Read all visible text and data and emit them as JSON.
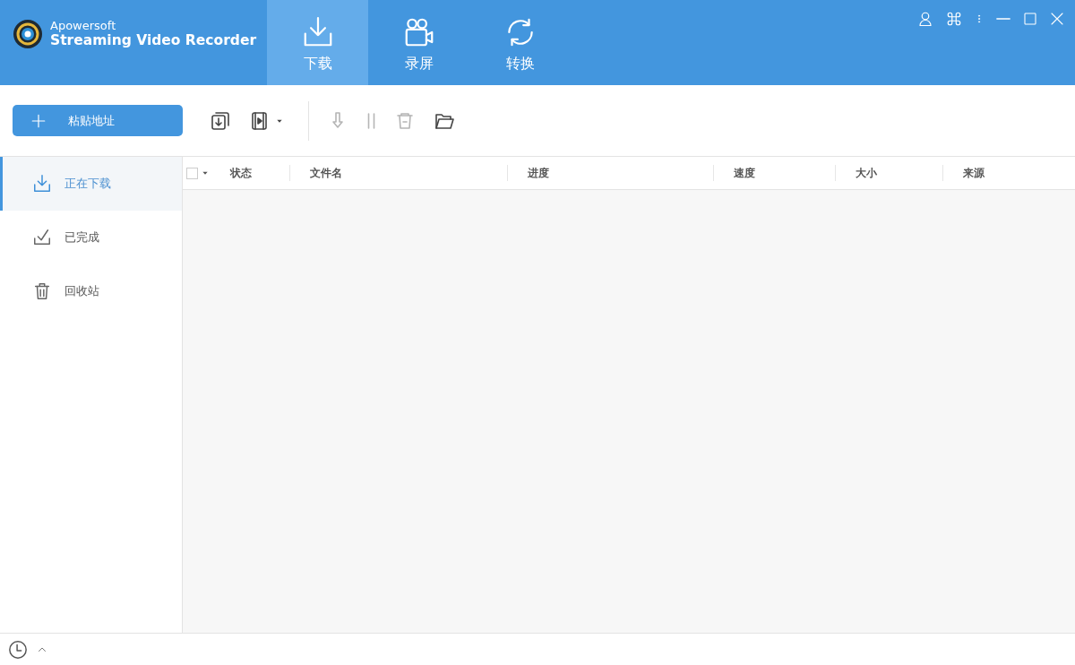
{
  "app": {
    "brand": "Apowersoft",
    "product": "Streaming Video Recorder"
  },
  "tabs": [
    {
      "label": "下载",
      "kind": "download",
      "selected": true
    },
    {
      "label": "录屏",
      "kind": "camera",
      "selected": false
    },
    {
      "label": "转换",
      "kind": "convert",
      "selected": false
    }
  ],
  "toolbar": {
    "paste_button": "粘贴地址",
    "tools": [
      {
        "kind": "batch",
        "disabled": false
      },
      {
        "kind": "video",
        "disabled": false
      },
      {
        "kind": "start",
        "disabled": true
      },
      {
        "kind": "pause",
        "disabled": true
      },
      {
        "kind": "delete",
        "disabled": true
      },
      {
        "kind": "folder",
        "disabled": false
      }
    ]
  },
  "sidebar": {
    "items": [
      {
        "label": "正在下载",
        "kind": "download",
        "selected": true
      },
      {
        "label": "已完成",
        "kind": "done",
        "selected": false
      },
      {
        "label": "回收站",
        "kind": "trash",
        "selected": false
      }
    ]
  },
  "table": {
    "select_all": {
      "checked": false
    },
    "columns": [
      "状态",
      "文件名",
      "进度",
      "速度",
      "大小",
      "来源"
    ]
  }
}
